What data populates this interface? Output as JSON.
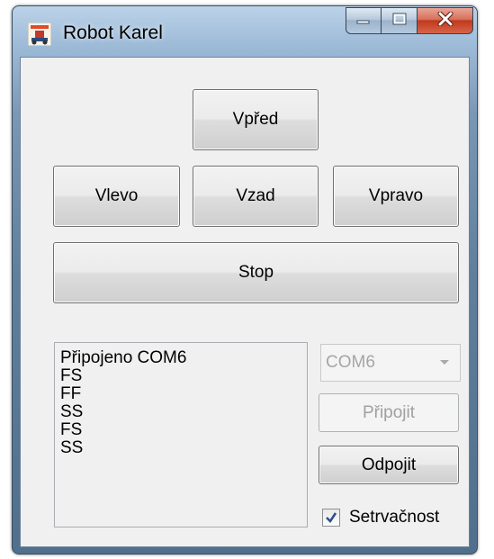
{
  "window": {
    "title": "Robot Karel",
    "icon": "robot-karel-app-icon"
  },
  "controls": {
    "forward_label": "Vpřed",
    "left_label": "Vlevo",
    "back_label": "Vzad",
    "right_label": "Vpravo",
    "stop_label": "Stop"
  },
  "log": {
    "lines": [
      "Připojeno COM6",
      "FS",
      "FF",
      "SS",
      "FS",
      "SS"
    ]
  },
  "connection": {
    "port_value": "COM6",
    "connect_label": "Připojit",
    "disconnect_label": "Odpojit",
    "inertia_label": "Setrvačnost",
    "inertia_checked": true
  },
  "colors": {
    "close_button": "#c1391c",
    "frame": "#7a98b6",
    "client_bg": "#f0f0f0"
  }
}
